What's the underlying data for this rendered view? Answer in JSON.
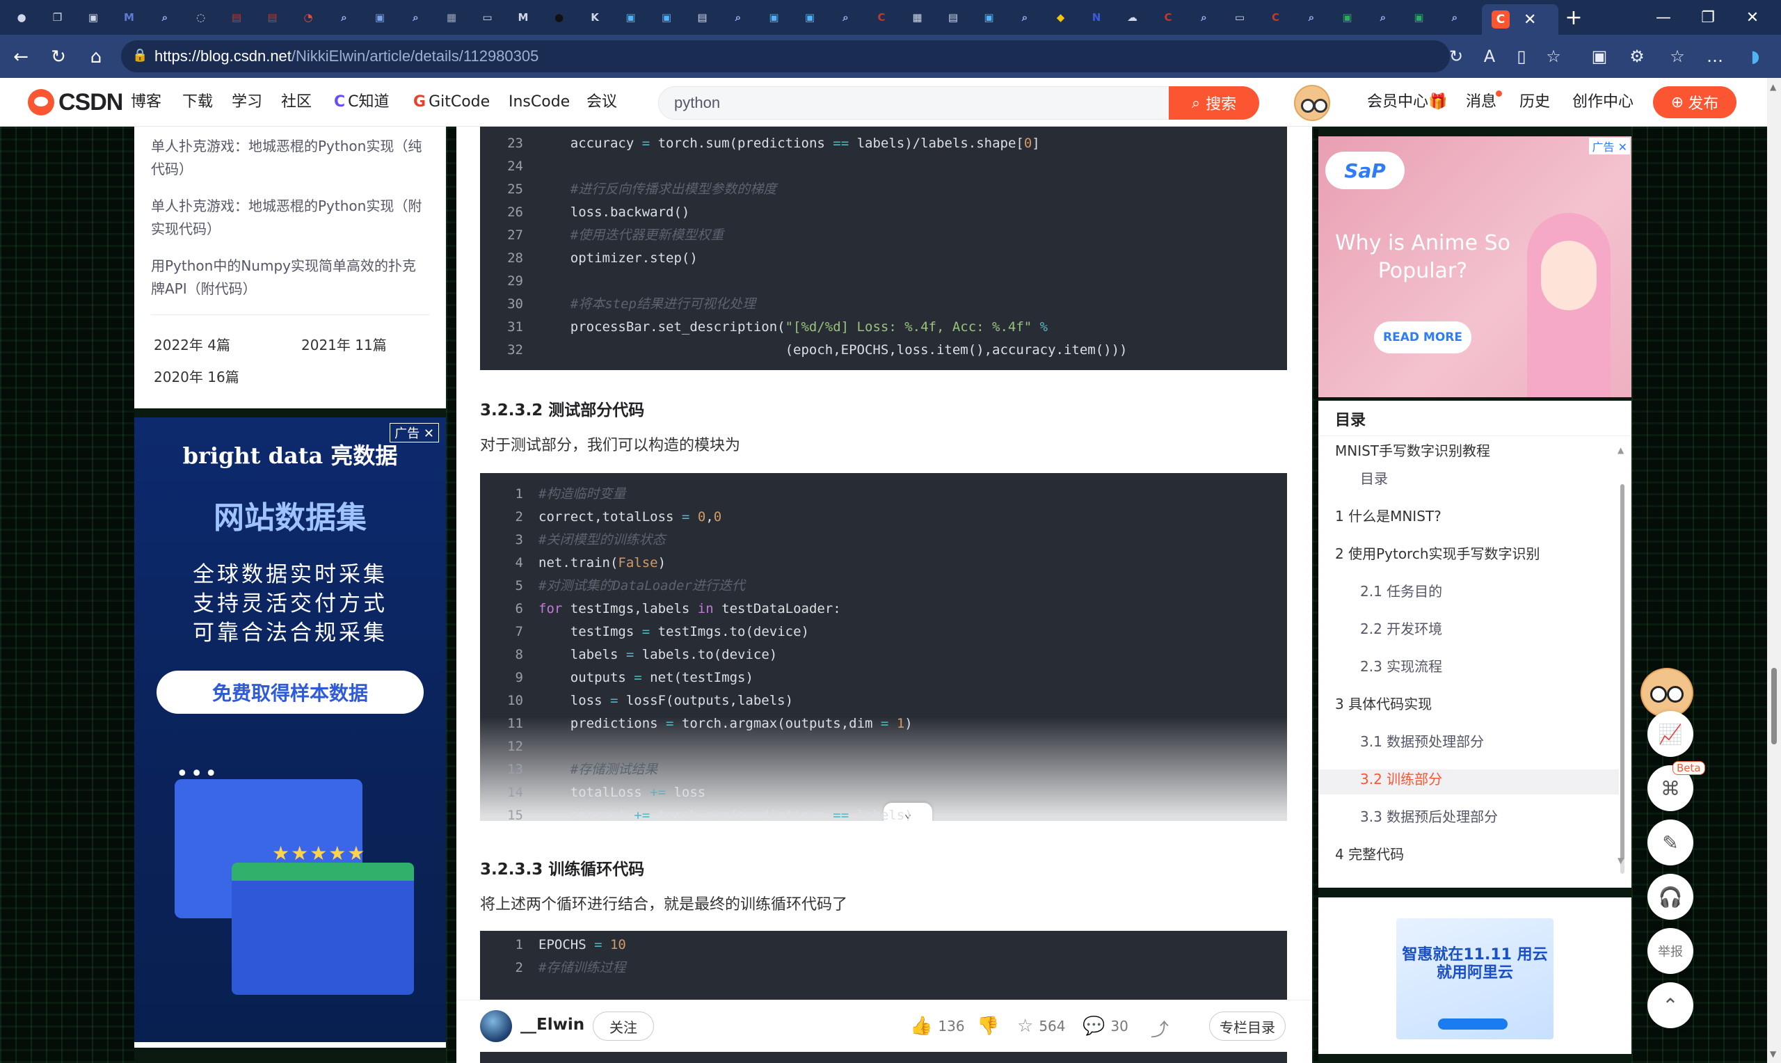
{
  "browser": {
    "tab_favicons": [
      {
        "name": "profile-icon",
        "glyph": "●",
        "color": "#cfd8ea"
      },
      {
        "name": "workspaces-icon",
        "glyph": "❐",
        "color": "#cfd8ea"
      },
      {
        "name": "tab-actions-icon",
        "glyph": "▣",
        "color": "#cfd8ea"
      },
      {
        "name": "tab-favicon-ms",
        "glyph": "M",
        "color": "#5b7bd5"
      },
      {
        "name": "tab-search-icon",
        "glyph": "⌕",
        "color": "#9fb6ff"
      },
      {
        "name": "tab-loading-icon",
        "glyph": "◌",
        "color": "#cfd8ea"
      },
      {
        "name": "tab-favicon-red",
        "glyph": "▤",
        "color": "#c0392b"
      },
      {
        "name": "tab-favicon-red2",
        "glyph": "▤",
        "color": "#c0392b"
      },
      {
        "name": "tab-loading-icon-2",
        "glyph": "◔",
        "color": "#e74c3c"
      },
      {
        "name": "tab-search-icon-2",
        "glyph": "⌕",
        "color": "#9fb6ff"
      },
      {
        "name": "tab-favicon-blue",
        "glyph": "▣",
        "color": "#7aa0e6"
      },
      {
        "name": "tab-search-icon-3",
        "glyph": "⌕",
        "color": "#9fb6ff"
      },
      {
        "name": "tab-favicon-gray",
        "glyph": "▦",
        "color": "#9aa4b8"
      },
      {
        "name": "tab-doc-icon",
        "glyph": "▭",
        "color": "#cfd8ea"
      },
      {
        "name": "tab-favicon-m",
        "glyph": "M",
        "color": "#cfd8ea"
      },
      {
        "name": "tab-favicon-github",
        "glyph": "●",
        "color": "#111"
      },
      {
        "name": "tab-favicon-k",
        "glyph": "K",
        "color": "#cfd8ea"
      },
      {
        "name": "tab-favicon-bili",
        "glyph": "▣",
        "color": "#4fb3f6"
      },
      {
        "name": "tab-favicon-bili2",
        "glyph": "▣",
        "color": "#4fb3f6"
      },
      {
        "name": "tab-favicon-lock",
        "glyph": "▤",
        "color": "#cfd8ea"
      },
      {
        "name": "tab-search-icon-4",
        "glyph": "⌕",
        "color": "#9fb6ff"
      },
      {
        "name": "tab-favicon-bili3",
        "glyph": "▣",
        "color": "#4fb3f6"
      },
      {
        "name": "tab-favicon-bili4",
        "glyph": "▣",
        "color": "#4fb3f6"
      },
      {
        "name": "tab-search-icon-5",
        "glyph": "⌕",
        "color": "#9fb6ff"
      },
      {
        "name": "tab-favicon-c",
        "glyph": "C",
        "color": "#c0392b"
      },
      {
        "name": "tab-favicon-grid",
        "glyph": "▦",
        "color": "#cfd8ea"
      },
      {
        "name": "tab-favicon-puzzle",
        "glyph": "▤",
        "color": "#cfd8ea"
      },
      {
        "name": "tab-favicon-bili5",
        "glyph": "▣",
        "color": "#4fb3f6"
      },
      {
        "name": "tab-search-icon-6",
        "glyph": "⌕",
        "color": "#9fb6ff"
      },
      {
        "name": "tab-favicon-python",
        "glyph": "◆",
        "color": "#f1c40f"
      },
      {
        "name": "tab-favicon-n",
        "glyph": "N",
        "color": "#3b5bdb"
      },
      {
        "name": "tab-favicon-cloud",
        "glyph": "☁",
        "color": "#cfd8ea"
      },
      {
        "name": "tab-favicon-c2",
        "glyph": "C",
        "color": "#c0392b"
      },
      {
        "name": "tab-search-icon-7",
        "glyph": "⌕",
        "color": "#9fb6ff"
      },
      {
        "name": "tab-doc-icon-2",
        "glyph": "▭",
        "color": "#cfd8ea"
      },
      {
        "name": "tab-favicon-c3",
        "glyph": "C",
        "color": "#c0392b"
      },
      {
        "name": "tab-search-icon-8",
        "glyph": "⌕",
        "color": "#9fb6ff"
      },
      {
        "name": "tab-favicon-green",
        "glyph": "▣",
        "color": "#27ae60"
      },
      {
        "name": "tab-search-icon-9",
        "glyph": "⌕",
        "color": "#9fb6ff"
      },
      {
        "name": "tab-favicon-green2",
        "glyph": "▣",
        "color": "#27ae60"
      },
      {
        "name": "tab-search-icon-10",
        "glyph": "⌕",
        "color": "#9fb6ff"
      }
    ],
    "active_tab_favicon": "C",
    "close_glyph": "✕",
    "new_tab_glyph": "+",
    "window_controls": [
      "—",
      "❐",
      "✕"
    ],
    "nav": {
      "back": "←",
      "reload": "↻",
      "home": "⌂"
    },
    "url": {
      "host": "https://blog.csdn.net",
      "path": "/NikkiElwin/article/details/112980305"
    },
    "toolbar_icons": [
      "↻",
      "A",
      "▯",
      "☆",
      "▣",
      "⚙",
      "☆",
      "…",
      "◗"
    ]
  },
  "header": {
    "logo_text": "CSDN",
    "nav": [
      {
        "label": "博客",
        "prefix": ""
      },
      {
        "label": "下载",
        "prefix": ""
      },
      {
        "label": "学习",
        "prefix": ""
      },
      {
        "label": "社区",
        "prefix": ""
      },
      {
        "label": "C知道",
        "prefix": "C"
      },
      {
        "label": "GitCode",
        "prefix": "G"
      },
      {
        "label": "InsCode",
        "prefix": ""
      },
      {
        "label": "会议",
        "prefix": ""
      }
    ],
    "search_value": "python",
    "search_button": "搜索",
    "user_nav": [
      "会员中心",
      "消息",
      "历史",
      "创作中心"
    ],
    "member_gift_icon": "🎁",
    "publish_button": "发布"
  },
  "left": {
    "related": [
      "单人扑克游戏：地城恶棍的Python实现（纯代码）",
      "单人扑克游戏：地城恶棍的Python实现（附实现代码）",
      "用Python中的Numpy实现简单高效的扑克牌API（附代码）"
    ],
    "archives": [
      {
        "year": "2022年",
        "count": "4篇"
      },
      {
        "year": "2021年",
        "count": "11篇"
      },
      {
        "year": "2020年",
        "count": "16篇"
      }
    ],
    "ad": {
      "tag": "广告",
      "brand": "bright data 亮数据",
      "headline": "网站数据集",
      "lines": [
        "全球数据实时采集",
        "支持灵活交付方式",
        "可靠合法合规采集"
      ],
      "cta": "免费取得样本数据",
      "stars": "★★★★★",
      "dots": "•••"
    }
  },
  "article": {
    "code1": [
      {
        "ln": "23",
        "html": "    accuracy <span class='op'>=</span> torch.sum(predictions <span class='op'>==</span> labels)/labels.shape[<span class='num'>0</span>]"
      },
      {
        "ln": "24",
        "html": ""
      },
      {
        "ln": "25",
        "html": "    <span class='cmt'>#进行反向传播求出模型参数的梯度</span>"
      },
      {
        "ln": "26",
        "html": "    loss.backward()"
      },
      {
        "ln": "27",
        "html": "    <span class='cmt'>#使用迭代器更新模型权重</span>"
      },
      {
        "ln": "28",
        "html": "    optimizer.step()"
      },
      {
        "ln": "29",
        "html": ""
      },
      {
        "ln": "30",
        "html": "    <span class='cmt'>#将本step结果进行可视化处理</span>"
      },
      {
        "ln": "31",
        "html": "    processBar.set_description(<span class='str'>\"[%d/%d] Loss: %.4f, Acc: %.4f\"</span> <span class='op'>%</span>"
      },
      {
        "ln": "32",
        "html": "                               (epoch,EPOCHS,loss.item(),accuracy.item()))"
      }
    ],
    "h_test": "3.2.3.2 测试部分代码",
    "p_test": "对于测试部分，我们可以构造的模块为",
    "code2": [
      {
        "ln": "1",
        "html": "<span class='cmt'>#构造临时变量</span>"
      },
      {
        "ln": "2",
        "html": "correct,totalLoss <span class='op'>=</span> <span class='num'>0</span>,<span class='num'>0</span>"
      },
      {
        "ln": "3",
        "html": "<span class='cmt'>#关闭模型的训练状态</span>"
      },
      {
        "ln": "4",
        "html": "net.train(<span class='bool'>False</span>)"
      },
      {
        "ln": "5",
        "html": "<span class='cmt'>#对测试集的DataLoader进行迭代</span>"
      },
      {
        "ln": "6",
        "html": "<span class='kw'>for</span> testImgs,labels <span class='kw'>in</span> testDataLoader:"
      },
      {
        "ln": "7",
        "html": "    testImgs <span class='op'>=</span> testImgs.to(device)"
      },
      {
        "ln": "8",
        "html": "    labels <span class='op'>=</span> labels.to(device)"
      },
      {
        "ln": "9",
        "html": "    outputs <span class='op'>=</span> net(testImgs)"
      },
      {
        "ln": "10",
        "html": "    loss <span class='op'>=</span> lossF(outputs,labels)"
      },
      {
        "ln": "11",
        "html": "    predictions <span class='op'>=</span> torch.argmax(outputs,dim <span class='op'>=</span> <span class='num'>1</span>)"
      },
      {
        "ln": "12",
        "html": ""
      },
      {
        "ln": "13",
        "html": "    <span class='cmt'>#存储测试结果</span>"
      },
      {
        "ln": "14",
        "html": "    totalLoss <span class='op'>+=</span> loss"
      },
      {
        "ln": "15",
        "html": "    correct <span class='op'>+=</span> torch.sum(predictions <span class='op'>==</span> labels)"
      }
    ],
    "expand_glyph": "⌄",
    "h_loop": "3.2.3.3 训练循环代码",
    "p_loop": "将上述两个循环进行结合，就是最终的训练循环代码了",
    "code3": [
      {
        "ln": "1",
        "html": "EPOCHS <span class='op'>=</span> <span class='num'>10</span>"
      },
      {
        "ln": "2",
        "html": "<span class='cmt'>#存储训练过程</span>"
      }
    ],
    "author": "__Elwin",
    "follow": "关注",
    "likes": "136",
    "favorites": "564",
    "comments": "30",
    "column_button": "专栏目录"
  },
  "right": {
    "ad": {
      "tag": "广告",
      "logo": "SaP",
      "headline": "Why is Anime So Popular?",
      "cta": "READ MORE"
    },
    "toc": {
      "title": "目录",
      "cut_item": "MNIST手写数字识别教程",
      "items": [
        {
          "label": "目录",
          "level": 2
        },
        {
          "label": "1 什么是MNIST?",
          "level": 1
        },
        {
          "label": "2 使用Pytorch实现手写数字识别",
          "level": 1
        },
        {
          "label": "2.1 任务目的",
          "level": 2
        },
        {
          "label": "2.2 开发环境",
          "level": 2
        },
        {
          "label": "2.3 实现流程",
          "level": 2
        },
        {
          "label": "3 具体代码实现",
          "level": 1
        },
        {
          "label": "3.1 数据预处理部分",
          "level": 2
        },
        {
          "label": "3.2 训练部分",
          "level": 2,
          "active": true
        },
        {
          "label": "3.3 数据预后处理部分",
          "level": 2
        },
        {
          "label": "4 完整代码",
          "level": 1
        }
      ],
      "active_color": "#fc5531"
    },
    "ad2": {
      "headline": "智惠就在11.11 用云就用阿里云"
    }
  },
  "sidetools": {
    "items": [
      {
        "name": "data-chart-icon",
        "glyph": "📈"
      },
      {
        "name": "ai-assistant-icon",
        "glyph": "⌘"
      },
      {
        "name": "edit-note-icon",
        "glyph": "✎"
      },
      {
        "name": "customer-service-icon",
        "glyph": "🎧"
      },
      {
        "name": "report-button",
        "glyph": "举报"
      },
      {
        "name": "back-to-top-icon",
        "glyph": "⌃"
      }
    ],
    "beta": "Beta"
  },
  "colors": {
    "brand": "#fc5531",
    "code_bg": "#282c34",
    "chrome": "#2b4377"
  }
}
